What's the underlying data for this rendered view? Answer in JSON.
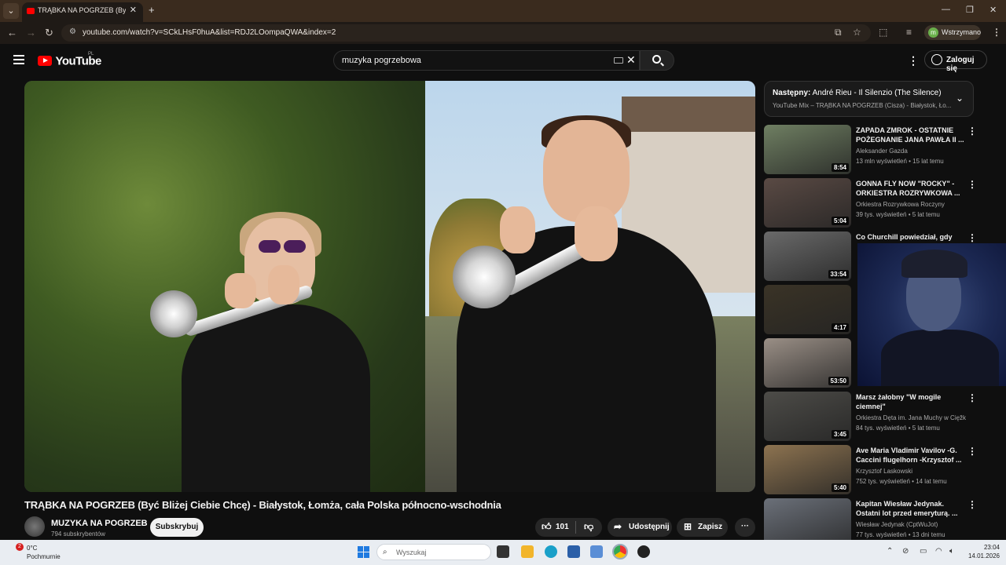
{
  "browser": {
    "tab_title": "TRĄBKA NA POGRZEB (Być Bliż...",
    "url": "youtube.com/watch?v=SCkLHsF0huA&list=RDJ2LOompaQWA&index=2",
    "profile_label": "Wstrzymano",
    "profile_initial": "m"
  },
  "masthead": {
    "logo_text": "YouTube",
    "country_code": "PL",
    "search_query": "muzyka pogrzebowa",
    "signin_label": "Zaloguj się"
  },
  "video": {
    "title": "TRĄBKA NA POGRZEB (Być Bliżej Ciebie Chcę) - Białystok, Łomża, cała Polska północno-wschodnia",
    "channel": "MUZYKA NA POGRZEB",
    "subscribers": "794 subskrybentów",
    "subscribe_label": "Subskrybuj",
    "likes": "101",
    "share_label": "Udostępnij",
    "save_label": "Zapisz"
  },
  "up_next": {
    "prefix": "Następny:",
    "title": "André Rieu - Il Silenzio (The Silence)",
    "mix": "YouTube Mix – TRĄBKA NA POGRZEB (Cisza) - Białystok, Ło..."
  },
  "recommendations": [
    {
      "title": "ZAPADA ZMROK - OSTATNIE POŻEGNANIE JANA PAWŁA II ...",
      "channel": "Aleksander Gazda",
      "meta": "13 mln wyświetleń • 15 lat temu",
      "duration": "8:54",
      "thumb_color": "#6f7f62"
    },
    {
      "title": "GONNA FLY NOW \"ROCKY\" - ORKIESTRA ROZRYWKOWA ...",
      "channel": "Orkiestra Rozrywkowa Roczyny",
      "meta": "39 tys. wyświetleń • 5 lat temu",
      "duration": "5:04",
      "thumb_color": "#5a4a44"
    },
    {
      "title": "Co Churchill powiedział, gdy",
      "channel": "",
      "meta": "",
      "duration": "33:54",
      "thumb_color": "#6a6a6a"
    },
    {
      "title": "",
      "channel": "",
      "meta": "",
      "duration": "4:17",
      "thumb_color": "#3a3326"
    },
    {
      "title": "",
      "channel": "",
      "meta": "",
      "duration": "53:50",
      "thumb_color": "#9a8f86"
    },
    {
      "title": "Marsz żałobny  \"W mogile ciemnej\"",
      "channel": "Orkiestra Dęta im. Jana Muchy w Cięžko...",
      "meta": "84 tys. wyświetleń • 5 lat temu",
      "duration": "3:45",
      "thumb_color": "#4d4c48"
    },
    {
      "title": "Ave Maria Vladimir Vavilov -G. Caccini flugelhorn -Krzysztof ...",
      "channel": "Krzysztof Laskowski",
      "meta": "752 tys. wyświetleń • 14 lat temu",
      "duration": "5:40",
      "thumb_color": "#8d7350"
    },
    {
      "title": "Kapitan Wiesław Jedynak. Ostatni lot przed emeryturą. ...",
      "channel": "Wiesław Jedynak (CptWuJot)",
      "meta": "77 tys. wyświetleń • 13 dni temu",
      "duration": "",
      "thumb_color": "#6b7079"
    }
  ],
  "taskbar": {
    "weather_badge": "2",
    "temperature": "0°C",
    "condition": "Pochmurnie",
    "search_placeholder": "Wyszukaj",
    "time": "23:04",
    "date": "14.01.2026"
  }
}
